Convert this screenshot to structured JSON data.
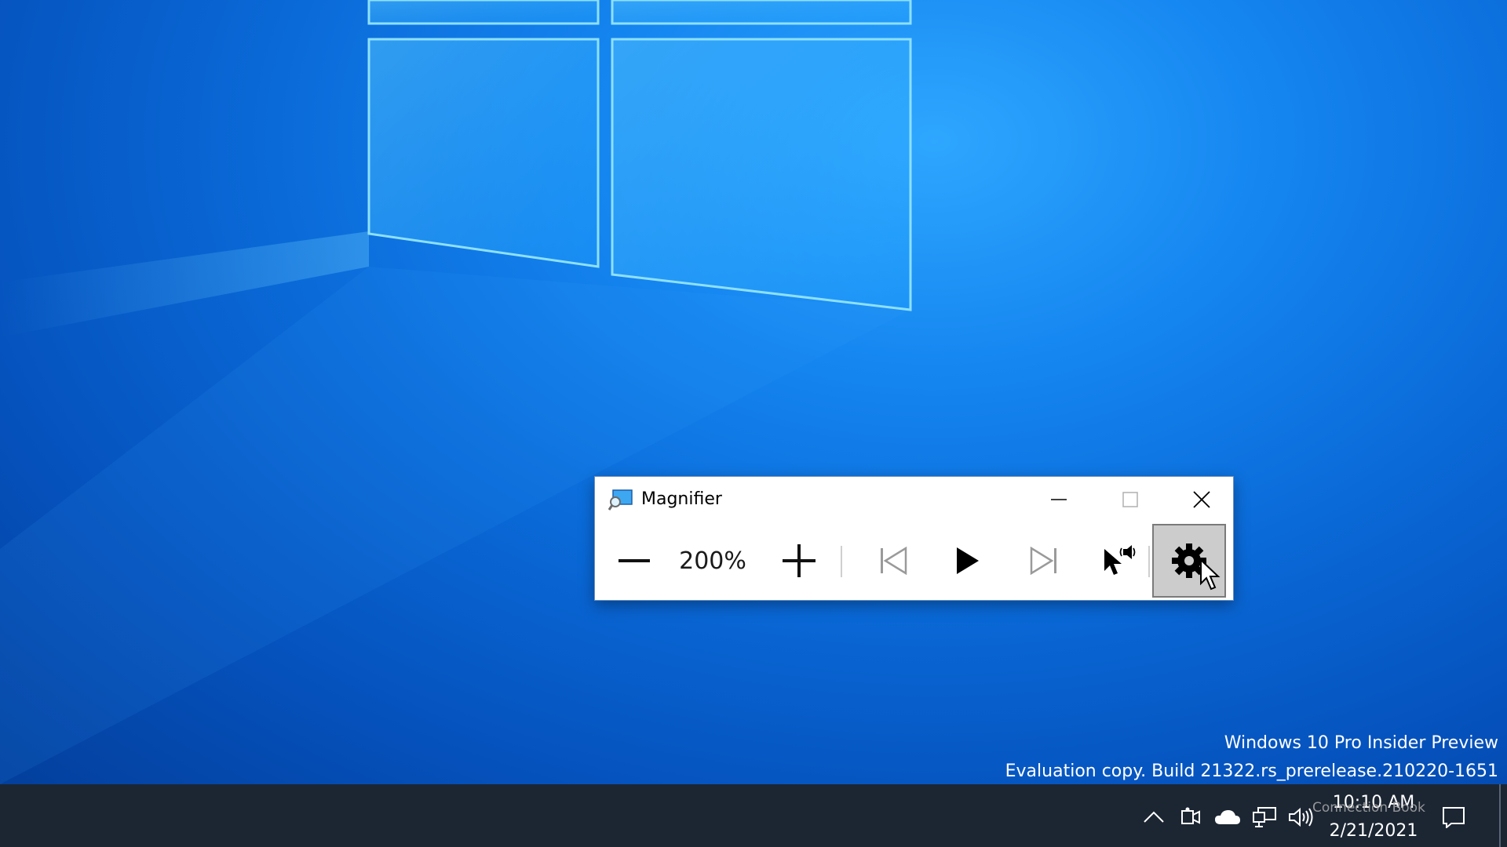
{
  "magnifier": {
    "title": "Magnifier",
    "zoom_level": "200%",
    "buttons": {
      "minimize_icon": "minimize-icon",
      "maximize_icon": "maximize-icon",
      "close_icon": "close-icon",
      "zoom_out_icon": "minus-icon",
      "zoom_in_icon": "plus-icon",
      "previous_icon": "skip-previous-icon",
      "play_icon": "play-icon",
      "next_icon": "skip-next-icon",
      "read_from_pointer_icon": "pointer-speaker-icon",
      "settings_icon": "gear-icon"
    }
  },
  "watermark": {
    "line1": "Windows 10 Pro Insider Preview",
    "line2": "Evaluation copy. Build 21322.rs_prerelease.210220-1651"
  },
  "taskbar": {
    "time": "10:10 AM",
    "date": "2/21/2021",
    "tray_icons": [
      "chevron-up-icon",
      "meet-now-icon",
      "onedrive-cloud-icon",
      "network-icon",
      "volume-icon"
    ],
    "notification_icon": "action-center-icon"
  },
  "overlay_text": "Connection Book",
  "colors": {
    "desktop_blue": "#0a6ad8",
    "taskbar": "#1c2633",
    "settings_pressed": "#cccccc"
  }
}
